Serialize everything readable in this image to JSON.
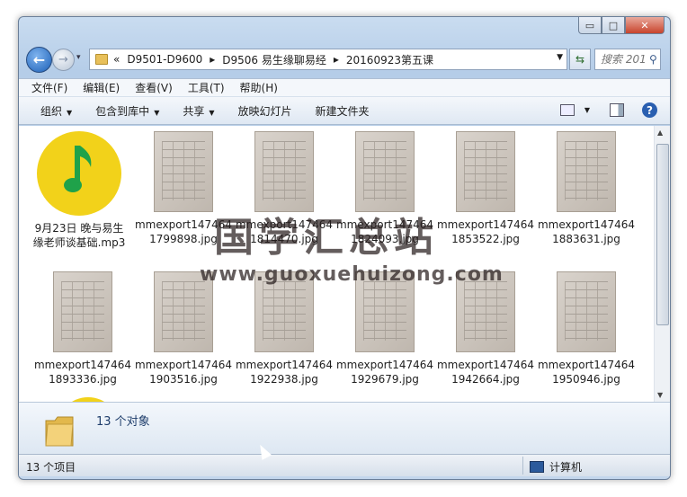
{
  "window": {
    "controls": {
      "minimize": "▭",
      "maximize": "□",
      "close": "✕"
    }
  },
  "nav": {
    "history_caret": "▾",
    "breadcrumb": [
      "«",
      "D9501-D9600",
      "▸",
      "D9506 易生缘聊易经",
      "▸",
      "20160923第五课"
    ],
    "search_placeholder": "搜索 2016..."
  },
  "menu": [
    "文件(F)",
    "编辑(E)",
    "查看(V)",
    "工具(T)",
    "帮助(H)"
  ],
  "toolbar": {
    "organize": "组织",
    "include_library": "包含到库中",
    "share": "共享",
    "slideshow": "放映幻灯片",
    "new_folder": "新建文件夹"
  },
  "files": [
    {
      "name": "9月23日 晚与易生缘老师谈基础.mp3",
      "type": "audio"
    },
    {
      "name": "mmexport1474641799898.jpg",
      "type": "image"
    },
    {
      "name": "mmexport1474641814470.jpg",
      "type": "image"
    },
    {
      "name": "mmexport1474641824093.jpg",
      "type": "image"
    },
    {
      "name": "mmexport1474641853522.jpg",
      "type": "image"
    },
    {
      "name": "mmexport1474641883631.jpg",
      "type": "image"
    },
    {
      "name": "mmexport1474641893336.jpg",
      "type": "image"
    },
    {
      "name": "mmexport1474641903516.jpg",
      "type": "image"
    },
    {
      "name": "mmexport1474641922938.jpg",
      "type": "image"
    },
    {
      "name": "mmexport1474641929679.jpg",
      "type": "image"
    },
    {
      "name": "mmexport1474641942664.jpg",
      "type": "image"
    },
    {
      "name": "mmexport1474641950946.jpg",
      "type": "image"
    }
  ],
  "details": {
    "count": "13 个对象"
  },
  "status": {
    "items": "13 个项目",
    "location": "计算机"
  },
  "watermark": {
    "cn": "国学汇总站",
    "url": "www.guoxuehuizong.com"
  },
  "colors": {
    "music_yellow": "#f2d21a",
    "music_green": "#1fa24a",
    "accent": "#1b5fb6"
  }
}
